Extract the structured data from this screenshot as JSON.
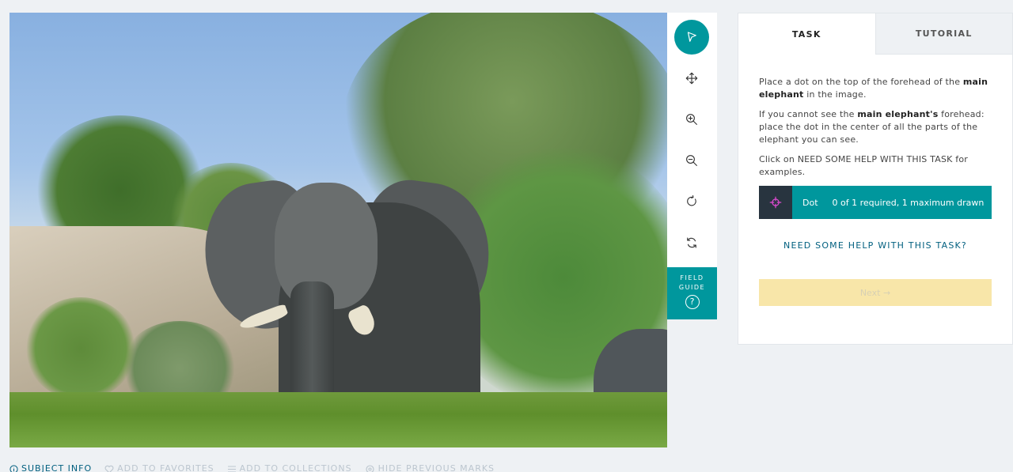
{
  "colors": {
    "accent": "#00979d",
    "tool_square": "#28343f",
    "next_disabled": "#f8e6a9",
    "link": "#005f7f"
  },
  "subject": {
    "description_icon_names": [
      "elephant-image"
    ]
  },
  "toolbar": {
    "buttons": [
      {
        "icon": "pointer-icon",
        "active": true
      },
      {
        "icon": "move-icon",
        "active": false
      },
      {
        "icon": "zoom-in-icon",
        "active": false
      },
      {
        "icon": "zoom-out-icon",
        "active": false
      },
      {
        "icon": "rotate-icon",
        "active": false
      },
      {
        "icon": "reset-icon",
        "active": false
      }
    ],
    "field_guide_label": "FIELD GUIDE",
    "field_guide_icon": "?"
  },
  "panel": {
    "tabs": [
      {
        "label": "TASK",
        "active": true
      },
      {
        "label": "TUTORIAL",
        "active": false
      }
    ],
    "instructions": {
      "p1_pre": "Place a dot on the top of the forehead of the ",
      "p1_bold": "main elephant",
      "p1_post": " in the image.",
      "p2_pre": "If you cannot see the ",
      "p2_bold": "main elephant's",
      "p2_post": " forehead: place the dot in the center of all the parts of the elephant you can see.",
      "p3": "Click on NEED SOME HELP WITH THIS TASK for examples."
    },
    "tool": {
      "name": "Dot",
      "requirement": "0 of 1 required, 1 maximum drawn",
      "icon": "crosshair-icon",
      "icon_color": "#e14bd3"
    },
    "help_link": "NEED SOME HELP WITH THIS TASK?",
    "next_label": "Next →"
  },
  "bottom_bar": {
    "subject_info": "SUBJECT INFO",
    "add_favorites": "ADD TO FAVORITES",
    "add_collections": "ADD TO COLLECTIONS",
    "hide_marks": "HIDE PREVIOUS MARKS"
  }
}
